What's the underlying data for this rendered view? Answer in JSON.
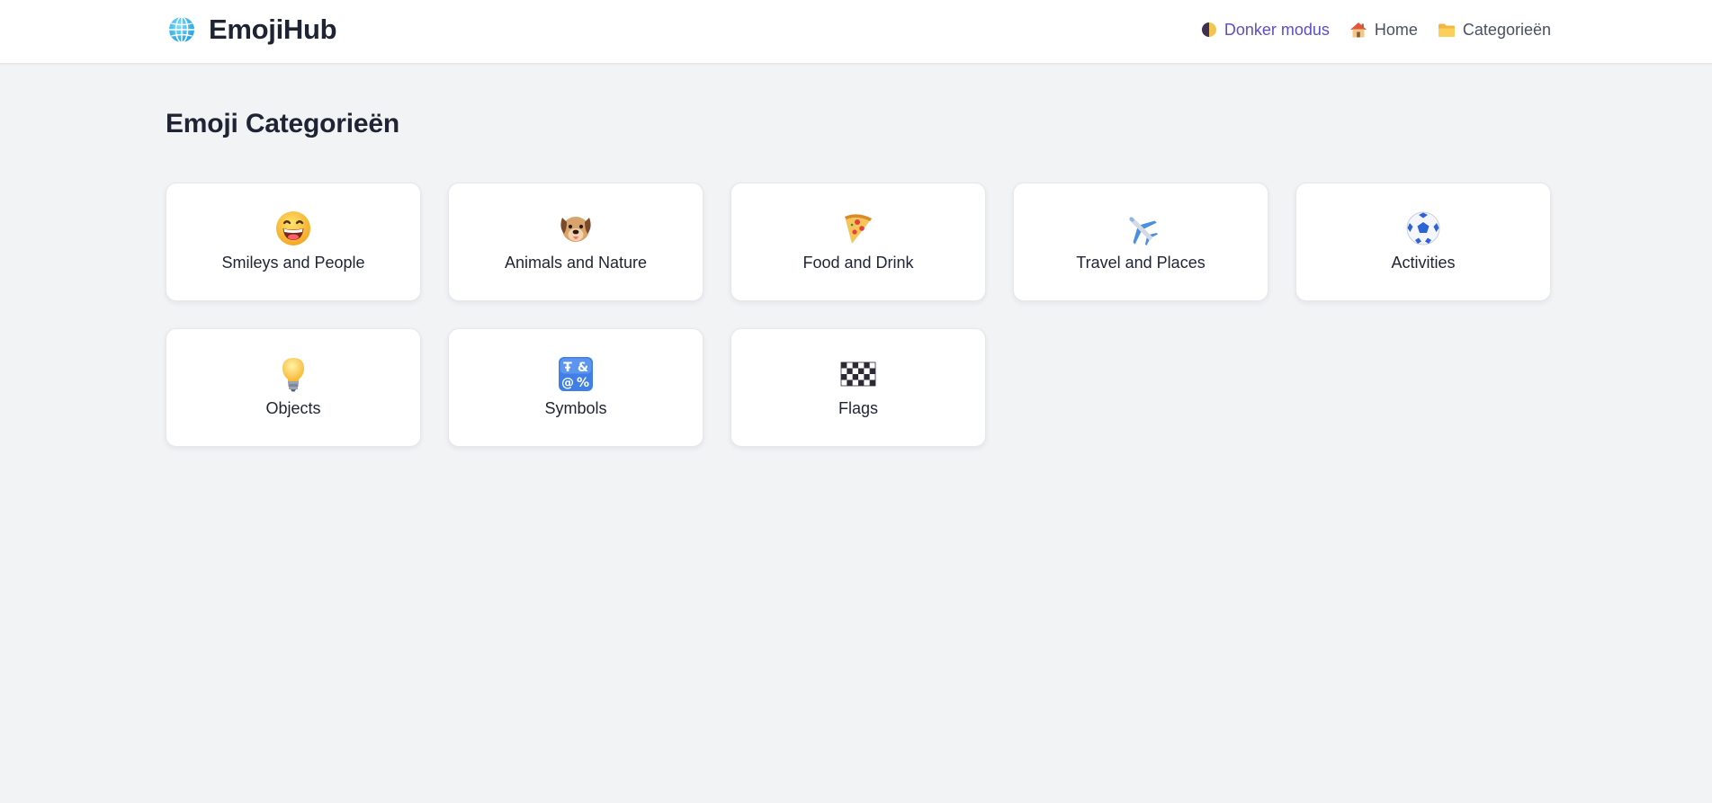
{
  "header": {
    "brand_name": "EmojiHub",
    "brand_icon": "globe-icon",
    "nav": {
      "dark_mode_label": "Donker modus",
      "dark_mode_icon": "half-moon-icon",
      "home_label": "Home",
      "home_icon": "house-icon",
      "categories_label": "Categorieën",
      "categories_icon": "folder-icon"
    }
  },
  "main": {
    "title": "Emoji Categorieën",
    "categories": [
      {
        "label": "Smileys and People",
        "icon": "grinning-face-icon"
      },
      {
        "label": "Animals and Nature",
        "icon": "dog-face-icon"
      },
      {
        "label": "Food and Drink",
        "icon": "pizza-icon"
      },
      {
        "label": "Travel and Places",
        "icon": "airplane-icon"
      },
      {
        "label": "Activities",
        "icon": "soccer-ball-icon"
      },
      {
        "label": "Objects",
        "icon": "light-bulb-icon"
      },
      {
        "label": "Symbols",
        "icon": "input-symbols-icon"
      },
      {
        "label": "Flags",
        "icon": "checkered-flag-icon"
      }
    ]
  },
  "colors": {
    "accent": "#5b4fc7",
    "background": "#f2f3f5",
    "card": "#ffffff",
    "text": "#1e2433"
  }
}
